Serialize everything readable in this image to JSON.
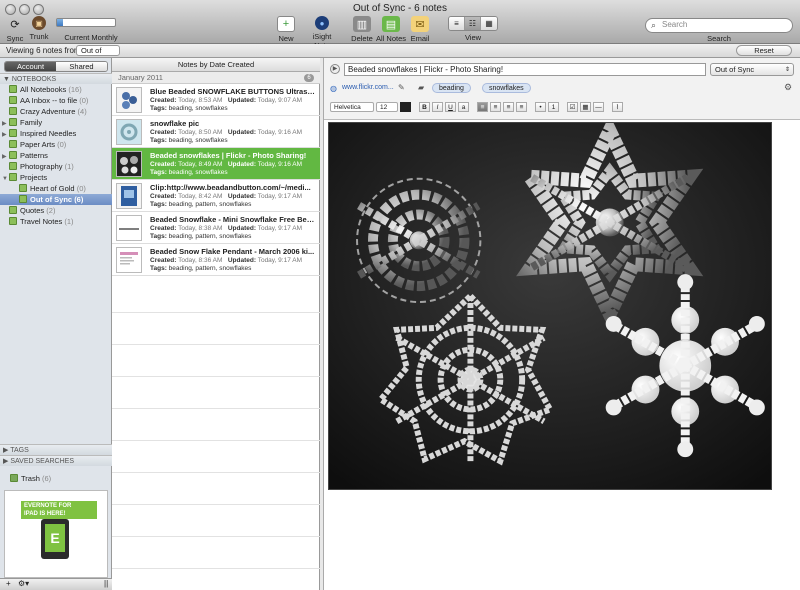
{
  "window": {
    "title": "Out of Sync - 6 notes"
  },
  "toolbar": {
    "sync": "Sync",
    "trunk": "Trunk",
    "usage_label": "Current Monthly Usage",
    "usage_progress": 0.1,
    "new_note": "New Note",
    "isight_note": "iSight Note",
    "delete": "Delete",
    "all_notes": "All Notes",
    "email": "Email",
    "view": "View",
    "search_placeholder": "Search",
    "search_label": "Search"
  },
  "filter": {
    "prefix": "Viewing 6 notes from",
    "notebook": "Out of Sync",
    "reset": "Reset"
  },
  "sidebar": {
    "tabs": [
      "Account",
      "Shared"
    ],
    "notebooks_header": "NOTEBOOKS",
    "notebooks": [
      {
        "label": "All Notebooks",
        "count": "(16)"
      },
      {
        "label": "AA Inbox -- to file",
        "count": "(0)"
      },
      {
        "label": "Crazy Adventure",
        "count": "(4)"
      },
      {
        "label": "Family",
        "count": ""
      },
      {
        "label": "Inspired Needles",
        "count": ""
      },
      {
        "label": "Paper Arts",
        "count": "(0)"
      },
      {
        "label": "Patterns",
        "count": ""
      },
      {
        "label": "Photography",
        "count": "(1)"
      },
      {
        "label": "Projects",
        "count": ""
      },
      {
        "label": "Heart of Gold",
        "count": "(0)"
      },
      {
        "label": "Out of Sync",
        "count": "(6)"
      },
      {
        "label": "Quotes",
        "count": "(2)"
      },
      {
        "label": "Travel Notes",
        "count": "(1)"
      }
    ],
    "tags_header": "TAGS",
    "saved_header": "SAVED SEARCHES",
    "trash": {
      "label": "Trash",
      "count": "(6)"
    },
    "ad": {
      "line1": "EVERNOTE FOR",
      "line2": "IPAD IS HERE!",
      "logo": "E"
    },
    "bottom": {
      "add": "+",
      "gear": "⚙▾"
    }
  },
  "notelist": {
    "header": "Notes by Date Created",
    "group": "January 2011",
    "group_count": "6",
    "created_label": "Created:",
    "updated_label": "Updated:",
    "tags_label": "Tags:",
    "notes": [
      {
        "title": "Blue Beaded SNOWFLAKE BUTTONS Ultrasued...",
        "created": "Today, 8:53 AM",
        "updated": "Today, 9:07 AM",
        "tags": "beading, snowflakes"
      },
      {
        "title": "snowflake pic",
        "created": "Today, 8:50 AM",
        "updated": "Today, 9:16 AM",
        "tags": "beading, snowflakes"
      },
      {
        "title": "Beaded snowflakes | Flickr - Photo Sharing!",
        "created": "Today, 8:49 AM",
        "updated": "Today, 9:16 AM",
        "tags": "beading, snowflakes"
      },
      {
        "title": "Clip:http://www.beadandbutton.com/~/medi...",
        "created": "Today, 8:42 AM",
        "updated": "Today, 9:17 AM",
        "tags": "beading, pattern, snowflakes"
      },
      {
        "title": "Beaded Snowflake - Mini Snowflake Free Bea...",
        "created": "Today, 8:38 AM",
        "updated": "Today, 9:17 AM",
        "tags": "beading, pattern, snowflakes"
      },
      {
        "title": "Beaded Snow Flake Pendant - March 2006 ki...",
        "created": "Today, 8:36 AM",
        "updated": "Today, 9:17 AM",
        "tags": "beading, pattern, snowflakes"
      }
    ]
  },
  "editor": {
    "title": "Beaded snowflakes | Flickr - Photo Sharing!",
    "notebook": "Out of Sync",
    "url": "www.flickr.com...",
    "tags": [
      "beading",
      "snowflakes"
    ],
    "font": "Helvetica",
    "size": "12",
    "bold": "B",
    "italic": "I",
    "underline": "U"
  }
}
